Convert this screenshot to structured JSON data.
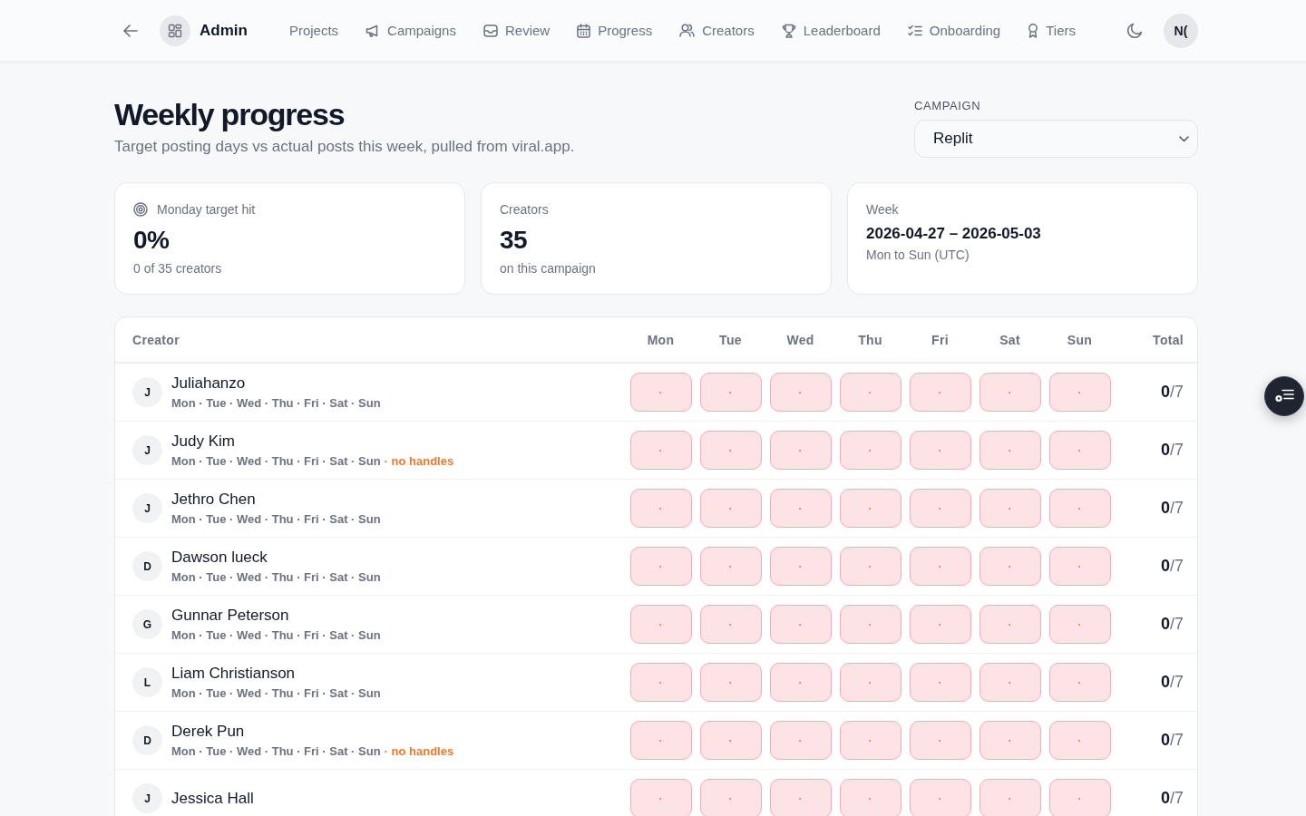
{
  "nav": {
    "brand": "Admin",
    "links": [
      {
        "label": "Projects"
      },
      {
        "label": "Campaigns"
      },
      {
        "label": "Review"
      },
      {
        "label": "Progress"
      },
      {
        "label": "Creators"
      },
      {
        "label": "Leaderboard"
      },
      {
        "label": "Onboarding"
      },
      {
        "label": "Tiers"
      }
    ],
    "avatar": "N("
  },
  "header": {
    "title": "Weekly progress",
    "subtitle": "Target posting days vs actual posts this week, pulled from viral.app."
  },
  "campaign_select": {
    "label": "CAMPAIGN",
    "value": "Replit"
  },
  "stats": [
    {
      "kind": "goal",
      "label": "Monday target hit",
      "value": "0%",
      "note": "0 of 35 creators"
    },
    {
      "kind": "count",
      "label": "Creators",
      "value": "35",
      "note": "on this campaign"
    },
    {
      "kind": "range",
      "label": "Week",
      "value": "2026-04-27 – 2026-05-03",
      "note": "Mon to Sun (UTC)"
    }
  ],
  "table": {
    "columns": [
      "Creator",
      "Mon",
      "Tue",
      "Wed",
      "Thu",
      "Fri",
      "Sat",
      "Sun",
      "Total"
    ],
    "rows": [
      {
        "initial": "J",
        "name": "Juliahanzo",
        "schedule": "Mon · Tue · Wed · Thu · Fri · Sat · Sun",
        "days": [
          {
            "mark": "·",
            "posted": false
          },
          {
            "mark": "·",
            "posted": false
          },
          {
            "mark": "·",
            "posted": false
          },
          {
            "mark": "·",
            "posted": false
          },
          {
            "mark": "·",
            "posted": false
          },
          {
            "mark": "·",
            "posted": false
          },
          {
            "mark": "·",
            "posted": false
          }
        ],
        "total": "**0**/7"
      },
      {
        "initial": "J",
        "name": "Judy Kim",
        "schedule": "Mon · Tue · Wed · Thu · Fri · Sat · Sun",
        "flag": "· no handles",
        "days": [
          {
            "mark": "·",
            "posted": false
          },
          {
            "mark": "·",
            "posted": false
          },
          {
            "mark": "·",
            "posted": false
          },
          {
            "mark": "·",
            "posted": false
          },
          {
            "mark": "·",
            "posted": false
          },
          {
            "mark": "·",
            "posted": false
          },
          {
            "mark": "·",
            "posted": false
          }
        ],
        "total": "**0**/7"
      },
      {
        "initial": "J",
        "name": "Jethro Chen",
        "schedule": "Mon · Tue · Wed · Thu · Fri · Sat · Sun",
        "days": [
          {
            "mark": "·",
            "posted": false
          },
          {
            "mark": "·",
            "posted": false
          },
          {
            "mark": "·",
            "posted": false
          },
          {
            "mark": "·",
            "posted": false
          },
          {
            "mark": "·",
            "posted": false
          },
          {
            "mark": "·",
            "posted": false
          },
          {
            "mark": "·",
            "posted": false
          }
        ],
        "total": "**0**/7"
      },
      {
        "initial": "D",
        "name": "Dawson lueck",
        "schedule": "Mon · Tue · Wed · Thu · Fri · Sat · Sun",
        "days": [
          {
            "mark": "·",
            "posted": false
          },
          {
            "mark": "·",
            "posted": false
          },
          {
            "mark": "·",
            "posted": false
          },
          {
            "mark": "·",
            "posted": false
          },
          {
            "mark": "·",
            "posted": false
          },
          {
            "mark": "·",
            "posted": false
          },
          {
            "mark": "·",
            "posted": false
          }
        ],
        "total": "**0**/7"
      },
      {
        "initial": "G",
        "name": "Gunnar Peterson",
        "schedule": "Mon · Tue · Wed · Thu · Fri · Sat · Sun",
        "days": [
          {
            "mark": "·",
            "posted": false
          },
          {
            "mark": "·",
            "posted": false
          },
          {
            "mark": "·",
            "posted": false
          },
          {
            "mark": "·",
            "posted": false
          },
          {
            "mark": "·",
            "posted": false
          },
          {
            "mark": "·",
            "posted": false
          },
          {
            "mark": "·",
            "posted": false
          }
        ],
        "total": "**0**/7"
      },
      {
        "initial": "L",
        "name": "Liam Christianson",
        "schedule": "Mon · Tue · Wed · Thu · Fri · Sat · Sun",
        "days": [
          {
            "mark": "·",
            "posted": false
          },
          {
            "mark": "·",
            "posted": false
          },
          {
            "mark": "·",
            "posted": false
          },
          {
            "mark": "·",
            "posted": false
          },
          {
            "mark": "·",
            "posted": false
          },
          {
            "mark": "·",
            "posted": false
          },
          {
            "mark": "·",
            "posted": false
          }
        ],
        "total": "**0**/7"
      },
      {
        "initial": "D",
        "name": "Derek Pun",
        "schedule": "Mon · Tue · Wed · Thu · Fri · Sat · Sun",
        "flag": "· no handles",
        "days": [
          {
            "mark": "·",
            "posted": false
          },
          {
            "mark": "·",
            "posted": false
          },
          {
            "mark": "·",
            "posted": false
          },
          {
            "mark": "·",
            "posted": false
          },
          {
            "mark": "·",
            "posted": false
          },
          {
            "mark": "·",
            "posted": false
          },
          {
            "mark": "·",
            "posted": false
          }
        ],
        "total": "**0**/7"
      },
      {
        "initial": "J",
        "name": "Jessica Hall",
        "days": [
          {
            "mark": "·",
            "posted": false
          },
          {
            "mark": "·",
            "posted": false
          },
          {
            "mark": "·",
            "posted": false
          },
          {
            "mark": "·",
            "posted": false
          },
          {
            "mark": "·",
            "posted": false
          },
          {
            "mark": "·",
            "posted": false
          },
          {
            "mark": "·",
            "posted": false
          }
        ],
        "total": "**0**/7"
      }
    ]
  }
}
